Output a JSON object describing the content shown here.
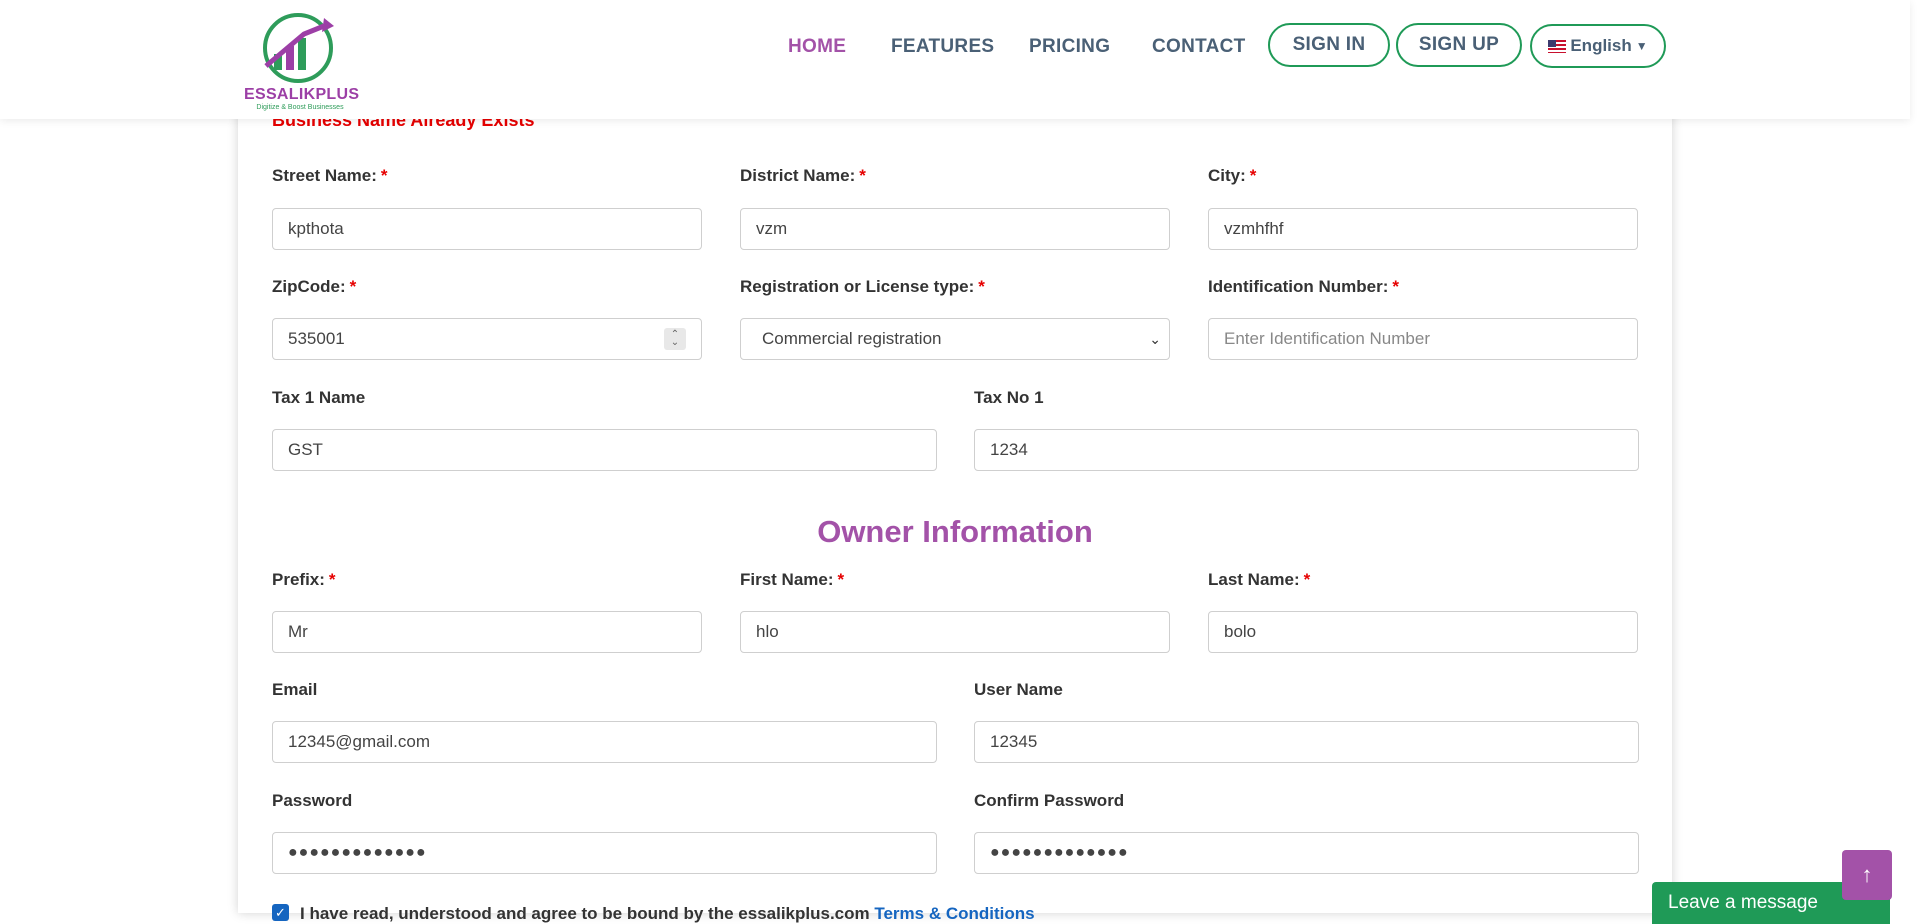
{
  "nav": {
    "logo_text": "ESSALIKPLUS",
    "logo_tagline": "Digitize & Boost Businesses",
    "links": [
      "HOME",
      "FEATURES",
      "PRICING",
      "CONTACT"
    ],
    "sign_in": "SIGN IN",
    "sign_up": "SIGN UP",
    "language": "English"
  },
  "form": {
    "error": "Business Name Already Exists",
    "street_label": "Street Name:",
    "street_value": "kpthota",
    "district_label": "District Name:",
    "district_value": "vzm",
    "city_label": "City:",
    "city_value": "vzmhfhf",
    "zip_label": "ZipCode:",
    "zip_value": "535001",
    "license_label": "Registration or License type:",
    "license_value": "Commercial registration",
    "id_label": "Identification Number:",
    "id_placeholder": "Enter Identification Number",
    "tax1_label": "Tax 1 Name",
    "tax1_value": "GST",
    "taxno_label": "Tax No 1",
    "taxno_value": "1234",
    "required_mark": "*"
  },
  "owner": {
    "title": "Owner Information",
    "prefix_label": "Prefix:",
    "prefix_value": "Mr",
    "first_label": "First Name:",
    "first_value": "hlo",
    "last_label": "Last Name:",
    "last_value": "bolo",
    "email_label": "Email",
    "email_value": "12345@gmail.com",
    "username_label": "User Name",
    "username_value": "12345",
    "password_label": "Password",
    "password_value": "●●●●●●●●●●●●●",
    "confirm_label": "Confirm Password",
    "confirm_value": "●●●●●●●●●●●●●"
  },
  "agreement": {
    "text": "I have read, understood and agree to be bound by the essalikplus.com",
    "link": "Terms & Conditions",
    "checked": true
  },
  "chat": {
    "label": "Leave a message"
  }
}
